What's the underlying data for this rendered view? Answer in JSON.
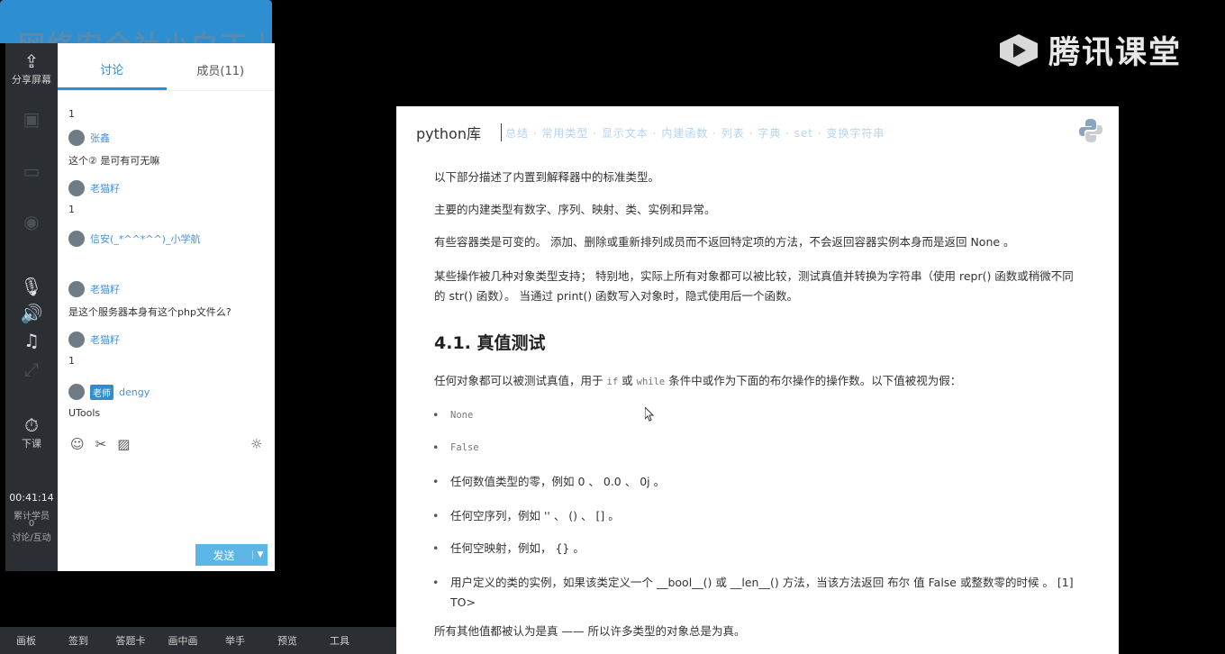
{
  "watermark": "网络安全社小白丁丨",
  "brand": {
    "name": "腾讯课堂"
  },
  "strip": {
    "share_label": "分享屏幕",
    "download_label": "下课",
    "timer": "00:41:14",
    "stat1": "累计学员",
    "stat2": "0",
    "stat3": "讨论/互动"
  },
  "chat": {
    "tabs": [
      "讨论",
      "成员(11)"
    ],
    "messages": [
      {
        "user": "",
        "text": "1"
      },
      {
        "user": "张鑫",
        "text": "这个② 是可有可无嘛"
      },
      {
        "user": "老猫籽",
        "text": "1"
      },
      {
        "user": "信安(_*^^*^^)_小学航",
        "text": ""
      },
      {
        "user": "老猫籽",
        "text": "是这个服务器本身有这个php文件么?"
      },
      {
        "user": "老猫籽",
        "text": "1"
      },
      {
        "user": "dengy",
        "badge": "老师",
        "text": "UTools"
      }
    ],
    "send_label": "发送",
    "send_arrow": "▼"
  },
  "bottombar": {
    "items": [
      "画板",
      "签到",
      "答题卡",
      "画中画",
      "举手",
      "预览",
      "工具"
    ]
  },
  "doc": {
    "title": "python库",
    "nav": "总结 · 常用类型 · 显示文本 · 内建函数 · 列表 · 字典 · set · 变换字符串",
    "paragraphs": [
      "以下部分描述了内置到解释器中的标准类型。",
      "主要的内建类型有数字、序列、映射、类、实例和异常。",
      "有些容器类是可变的。 添加、删除或重新排列成员而不返回特定项的方法，不会返回容器实例本身而是返回 None 。",
      "某些操作被几种对象类型支持； 特别地，实际上所有对象都可以被比较，测试真值并转换为字符串（使用 repr() 函数或稍微不同的 str() 函数）。 当通过 print() 函数写入对象时，隐式使用后一个函数。"
    ],
    "heading": "4.1. 真值测试",
    "intro_before": "任何对象都可以被测试真值，用于",
    "intro_if": "if",
    "intro_mid1": "或",
    "intro_while": "while",
    "intro_after": "条件中或作为下面的布尔操作的操作数。以下值被视为假：",
    "list": [
      "None",
      "False",
      "任何数值类型的零，例如 0 、 0.0 、 0j 。",
      "任何空序列，例如 '' 、 () 、 [] 。",
      "任何空映射，例如， {} 。",
      "用户定义的类的实例，如果该类定义一个 __bool__() 或 __len__() 方法，当该方法返回 布尔 值 False 或整数零的时候 。 [1] TO>"
    ],
    "final": "所有其他值都被认为是真 —— 所以许多类型的对象总是为真。"
  }
}
